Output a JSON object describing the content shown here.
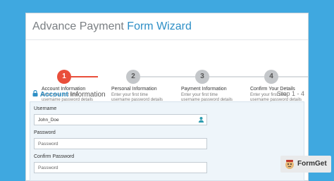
{
  "header": {
    "title_part1": "Advance Payment ",
    "title_accent": "Form Wizard"
  },
  "steps": [
    {
      "number": "1",
      "title": "Account Information",
      "desc": "Enter your first time username password details",
      "active": true
    },
    {
      "number": "2",
      "title": "Personal Information",
      "desc": "Enter your first time username password details",
      "active": false
    },
    {
      "number": "3",
      "title": "Payment Information",
      "desc": "Enter your first time username password details",
      "active": false
    },
    {
      "number": "4",
      "title": "Confirm Your Details",
      "desc": "Enter your first time username password details",
      "active": false
    }
  ],
  "section": {
    "strong": "Account",
    "rest": " Information",
    "step_count": "Step 1 - 4"
  },
  "form": {
    "username_label": "Username",
    "username_value": "John_Doe",
    "password_label": "Password",
    "password_placeholder": "Password",
    "confirm_label": "Confirm Password",
    "confirm_placeholder": "Password"
  },
  "badge": {
    "brand": "FormGet"
  },
  "colors": {
    "background": "#3fa8e0",
    "accent": "#2e8fc6",
    "active_step": "#e94f3b"
  },
  "icons": {
    "lock": "lock-icon",
    "user": "user-icon",
    "logo": "formget-logo-icon"
  }
}
